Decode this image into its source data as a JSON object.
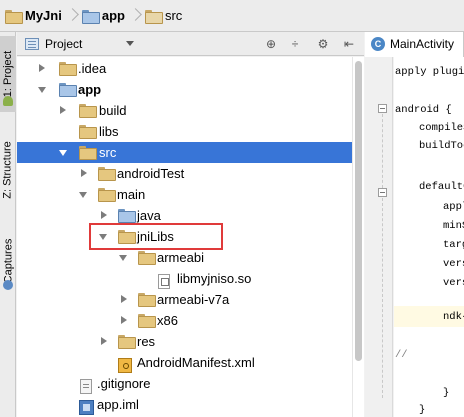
{
  "breadcrumb": {
    "items": [
      {
        "label": "MyJni",
        "bold": true
      },
      {
        "label": "app",
        "bold": true
      },
      {
        "label": "src",
        "bold": false
      }
    ]
  },
  "side_tabs": {
    "project": "1: Project",
    "structure": "Z: Structure",
    "captures": "Captures"
  },
  "project_panel": {
    "view_selector": "Project",
    "header_icons": [
      "crosshair-icon",
      "collapse-all-icon",
      "gear-icon",
      "hide-panel-icon"
    ]
  },
  "tree": [
    {
      "label": ".idea",
      "type": "folder",
      "expanded": false
    },
    {
      "label": "app",
      "type": "folder",
      "expanded": true,
      "bold": true
    },
    {
      "label": "build",
      "type": "folder",
      "expanded": false
    },
    {
      "label": "libs",
      "type": "folder"
    },
    {
      "label": "src",
      "type": "folder",
      "expanded": true,
      "selected": true
    },
    {
      "label": "androidTest",
      "type": "folder",
      "expanded": false
    },
    {
      "label": "main",
      "type": "folder",
      "expanded": true
    },
    {
      "label": "java",
      "type": "source-folder",
      "expanded": false
    },
    {
      "label": "jniLibs",
      "type": "folder",
      "expanded": true,
      "highlighted": true
    },
    {
      "label": "armeabi",
      "type": "folder",
      "expanded": true
    },
    {
      "label": "libmyjniso.so",
      "type": "file"
    },
    {
      "label": "armeabi-v7a",
      "type": "folder",
      "expanded": false
    },
    {
      "label": "x86",
      "type": "folder",
      "expanded": false
    },
    {
      "label": "res",
      "type": "folder",
      "expanded": false
    },
    {
      "label": "AndroidManifest.xml",
      "type": "xml-file"
    },
    {
      "label": ".gitignore",
      "type": "file"
    },
    {
      "label": "app.iml",
      "type": "module-file"
    }
  ],
  "editor": {
    "tab_label": "MainActivity",
    "lines": [
      "apply plugin",
      "",
      "android {",
      "compileS",
      "buildToo",
      "",
      "defaultC",
      "appl",
      "minS",
      "targ",
      "vers",
      "vers",
      "",
      "ndk{",
      "",
      "",
      "//",
      "",
      "",
      "}",
      "}"
    ]
  },
  "colors": {
    "selection": "#3875d7",
    "highlight_box": "#e03a3a"
  }
}
